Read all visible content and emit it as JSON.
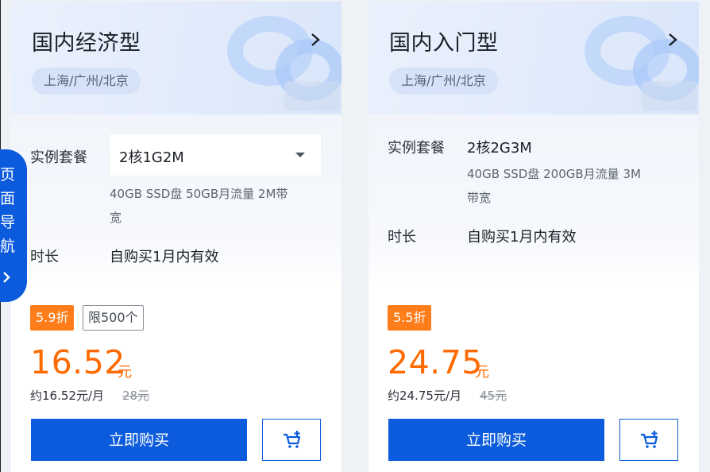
{
  "cards": [
    {
      "title": "国内经济型",
      "region": "上海/广州/北京",
      "spec_label": "实例套餐",
      "spec_value": "2核1G2M",
      "spec_desc_line1": "40GB SSD盘 50GB月流量 2M带",
      "spec_desc_line2": "宽",
      "duration_label": "时长",
      "duration_value": "自购买1月内有效",
      "discount": "5.9折",
      "limit": "限500个",
      "price": "16.52",
      "price_unit": "元",
      "monthly": "约16.52元/月",
      "original_price": "28元",
      "buy_label": "立即购买"
    },
    {
      "title": "国内入门型",
      "region": "上海/广州/北京",
      "spec_label": "实例套餐",
      "spec_value": "2核2G3M",
      "spec_desc_line1": "40GB SSD盘 200GB月流量 3M",
      "spec_desc_line2": "带宽",
      "duration_label": "时长",
      "duration_value": "自购买1月内有效",
      "discount": "5.5折",
      "price": "24.75",
      "price_unit": "元",
      "monthly": "约24.75元/月",
      "original_price": "45元",
      "buy_label": "立即购买"
    }
  ],
  "page_nav": {
    "chars": [
      "页",
      "面",
      "导",
      "航"
    ]
  },
  "icons": {
    "title_arrow": "chevron-right-icon",
    "cart": "cart-add-icon",
    "dropdown": "caret-down-icon"
  },
  "colors": {
    "primary": "#0b5bdc",
    "price": "#ff6a00",
    "discount": "#ff7d1a"
  }
}
